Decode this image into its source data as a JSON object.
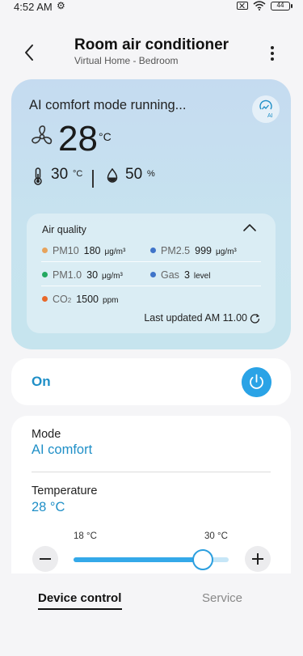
{
  "status_bar": {
    "time": "4:52 AM",
    "battery": "44"
  },
  "header": {
    "title": "Room air conditioner",
    "subtitle": "Virtual Home - Bedroom"
  },
  "ai_card": {
    "status_text": "AI comfort mode running...",
    "badge_label": "AI",
    "set_temperature": "28",
    "set_temperature_unit": "°C",
    "indoor_temperature": "30",
    "indoor_temperature_unit": "°C",
    "humidity": "50",
    "humidity_unit": "%",
    "air_quality": {
      "title": "Air quality",
      "items": [
        {
          "name": "PM10",
          "value": "180",
          "unit": "μg/m³",
          "color": "#e7a35c"
        },
        {
          "name": "PM2.5",
          "value": "999",
          "unit": "μg/m³",
          "color": "#3f74c9"
        },
        {
          "name": "PM1.0",
          "value": "30",
          "unit": "μg/m³",
          "color": "#23a860"
        },
        {
          "name": "Gas",
          "value": "3",
          "unit": "level",
          "color": "#3f74c9"
        },
        {
          "name": "CO",
          "name_sub": "2",
          "value": "1500",
          "unit": "ppm",
          "color": "#e8692a"
        }
      ],
      "last_updated": "Last updated AM 11.00"
    }
  },
  "power": {
    "label": "On",
    "is_on": true
  },
  "control": {
    "mode_label": "Mode",
    "mode_value": "AI comfort",
    "temperature_label": "Temperature",
    "temperature_value": "28 °C",
    "range_min": "18 °C",
    "range_max": "30 °C",
    "slider_fraction": 0.833
  },
  "tabs": {
    "device_control": "Device control",
    "service": "Service"
  },
  "colors": {
    "accent": "#1f8fc7",
    "power_button": "#2aa3e6",
    "slider": "#34a9e9"
  }
}
